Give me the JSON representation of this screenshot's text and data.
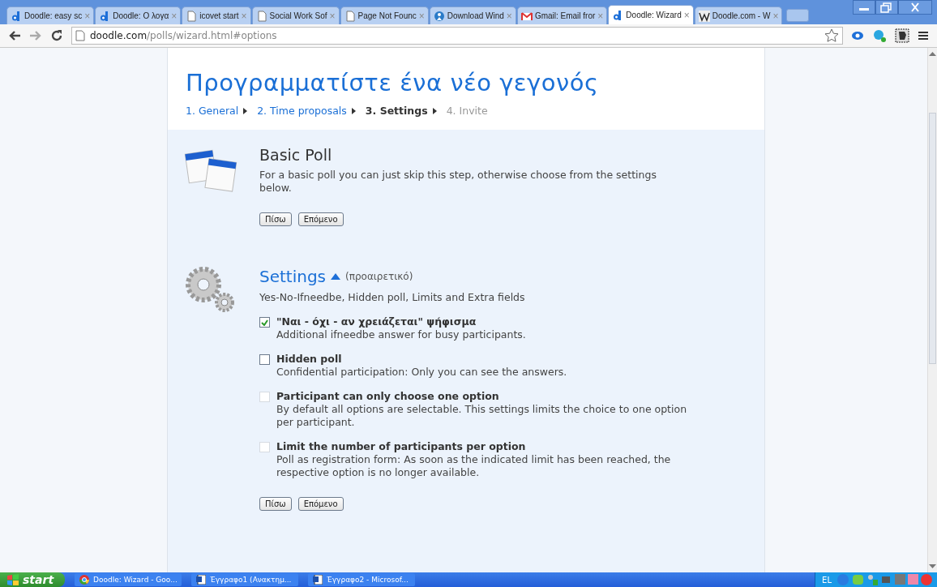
{
  "browser": {
    "tabs": [
      {
        "title": "Doodle: easy sc",
        "kind": "doodle",
        "selected": false
      },
      {
        "title": "Doodle: Ο λογα",
        "kind": "doodle",
        "selected": false
      },
      {
        "title": "icovet start",
        "kind": "page",
        "selected": false
      },
      {
        "title": "Social Work Sof",
        "kind": "page",
        "selected": false
      },
      {
        "title": "Page Not Founc",
        "kind": "page",
        "selected": false
      },
      {
        "title": "Download Wind",
        "kind": "help",
        "selected": false
      },
      {
        "title": "Gmail: Email fror",
        "kind": "mail",
        "selected": false
      },
      {
        "title": "Doodle: Wizard",
        "kind": "doodle",
        "selected": true
      },
      {
        "title": "Doodle.com - W",
        "kind": "wiki",
        "selected": false
      }
    ],
    "tab_close": "×",
    "address": {
      "host": "doodle.com",
      "path": "/polls/wizard.html#options"
    }
  },
  "page": {
    "title": "Προγραμματίστε ένα νέο γεγονός",
    "steps": [
      {
        "label": "1. General",
        "selected": false,
        "disabled": false
      },
      {
        "label": "2. Time proposals",
        "selected": false,
        "disabled": false
      },
      {
        "label": "3. Settings",
        "selected": true,
        "disabled": false
      },
      {
        "label": "4. Invite",
        "selected": false,
        "disabled": true
      }
    ],
    "basic": {
      "heading": "Basic Poll",
      "text": "For a basic poll you can just skip this step, otherwise choose from the settings below.",
      "buttons": [
        "Πίσω",
        "Επόμενο"
      ]
    },
    "settings": {
      "heading": "Settings",
      "expanded": true,
      "optional": "(προαιρετικό)",
      "summary": "Yes-No-Ifneedbe, Hidden poll, Limits and Extra fields",
      "options": [
        {
          "label": "\"Ναι - όχι - αν χρειάζεται\" ψήφισμα",
          "description": "Additional ifneedbe answer for busy participants.",
          "checked": true,
          "disabled": false
        },
        {
          "label": "Hidden poll",
          "description": "Confidential participation: Only you can see the answers.",
          "checked": false,
          "disabled": false
        },
        {
          "label": "Participant can only choose one option",
          "description": "By default all options are selectable. This settings limits the choice to one option per participant.",
          "checked": false,
          "disabled": true
        },
        {
          "label": "Limit the number of participants per option",
          "description": "Poll as registration form: As soon as the indicated limit has been reached, the respective option is no longer available.",
          "checked": false,
          "disabled": true
        }
      ],
      "buttons": [
        "Πίσω",
        "Επόμενο"
      ]
    }
  },
  "taskbar": {
    "start": "start",
    "items": [
      {
        "label": "Doodle: Wizard - Goo...",
        "kind": "chrome",
        "selected": false
      },
      {
        "label": "Έγγραφο1 (Ανακτημ...",
        "kind": "word",
        "selected": false
      },
      {
        "label": "Έγγραφο2 - Microsof...",
        "kind": "word",
        "selected": false
      }
    ],
    "language": "EL"
  }
}
